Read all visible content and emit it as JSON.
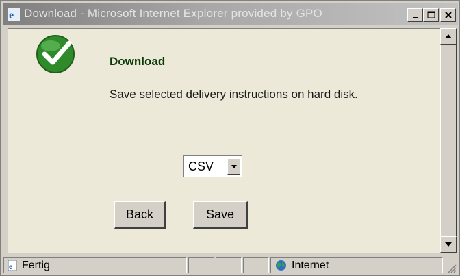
{
  "window": {
    "title": "Download - Microsoft Internet Explorer provided by GPO",
    "icon": "ie-icon"
  },
  "dialog": {
    "heading": "Download",
    "description": "Save selected delivery instructions on hard disk.",
    "format_select": {
      "selected": "CSV"
    },
    "back_label": "Back",
    "save_label": "Save"
  },
  "status": {
    "left_text": "Fertig",
    "zone_text": "Internet"
  },
  "colors": {
    "heading": "#0a3a0a",
    "check_green": "#2f8a2a",
    "panel_bg": "#ece9d8"
  }
}
